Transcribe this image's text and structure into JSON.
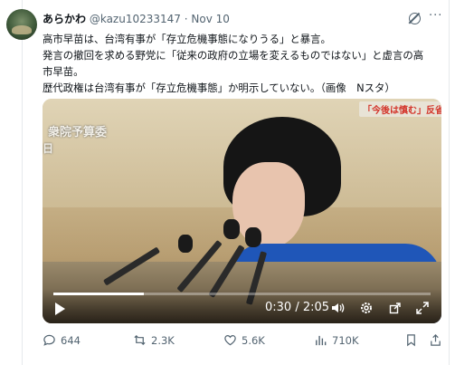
{
  "author": {
    "display_name": "あらかわ",
    "handle": "@kazu10233147",
    "date": "Nov 10"
  },
  "tweet": {
    "lines": [
      "高市早苗は、台湾有事が「存立危機事態になりうる」と暴言。",
      "発言の撤回を求める野党に「従来の政府の立場を変えるものではない」と虚言の高",
      "市早苗。",
      "歴代政権は台湾有事が「存立危機事態」か明示していない。（画像　Nスタ）"
    ]
  },
  "video": {
    "overlay_title": "衆院予算委",
    "overlay_sub": "日",
    "caption": "「今後は慎む」反省",
    "time": "0:30 / 2:05",
    "progress": 0.24
  },
  "actions": {
    "replies": "644",
    "reposts": "2.3K",
    "likes": "5.6K",
    "views": "710K"
  },
  "colors": {
    "text": "#0f1419",
    "muted": "#536471",
    "jacket": "#1f56b8"
  }
}
